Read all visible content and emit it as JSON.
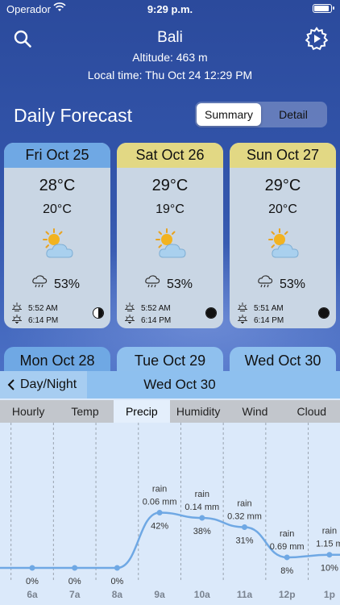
{
  "status_bar": {
    "carrier": "Operador",
    "time": "9:29 p.m."
  },
  "header": {
    "location": "Bali",
    "altitude": "Altitude: 463 m",
    "local_time": "Local time: Thu Oct 24 12:29 PM",
    "search_icon": "search-icon",
    "settings_icon": "gear-play-icon"
  },
  "daily": {
    "title": "Daily Forecast",
    "segments": [
      "Summary",
      "Detail"
    ],
    "selected_segment": "Summary",
    "cards": [
      {
        "day": "Fri Oct 25",
        "high": "28°C",
        "low": "20°C",
        "icon": "partly-cloudy-icon",
        "rain": "53%",
        "sunrise": "5:52 AM",
        "sunset": "6:14 PM",
        "moon": "last-quarter",
        "head_color": "#6fa8e4"
      },
      {
        "day": "Sat Oct 26",
        "high": "29°C",
        "low": "19°C",
        "icon": "partly-cloudy-icon",
        "rain": "53%",
        "sunrise": "5:52 AM",
        "sunset": "6:14 PM",
        "moon": "new",
        "head_color": "#e2d884"
      },
      {
        "day": "Sun Oct 27",
        "high": "29°C",
        "low": "20°C",
        "icon": "partly-cloudy-icon",
        "rain": "53%",
        "sunrise": "5:51 AM",
        "sunset": "6:14 PM",
        "moon": "new",
        "head_color": "#e2d884"
      }
    ],
    "next_cards": [
      {
        "day": "Mon Oct 28",
        "color": "#6fa8e4"
      },
      {
        "day": "Tue Oct 29",
        "color": "#8fc0ee"
      },
      {
        "day": "Wed Oct 30",
        "color": "#8fc0ee"
      }
    ]
  },
  "detail": {
    "back_label": "Day/Night",
    "title": "Wed Oct 30",
    "tabs": [
      "Hourly",
      "Temp",
      "Precip",
      "Humidity",
      "Wind",
      "Cloud"
    ],
    "active_tab": "Precip"
  },
  "chart_data": {
    "type": "line",
    "categories": [
      "6a",
      "7a",
      "8a",
      "9a",
      "10a",
      "11a",
      "12p",
      "1p"
    ],
    "series": [
      {
        "values": [
          0,
          0,
          0,
          42,
          38,
          31,
          8,
          10
        ],
        "labels": [
          "0%",
          "0%",
          "0%",
          "42%",
          "38%",
          "31%",
          "8%",
          "10%"
        ],
        "annotations": [
          null,
          null,
          null,
          [
            "rain",
            "0.06 mm"
          ],
          [
            "rain",
            "0.14 mm"
          ],
          [
            "rain",
            "0.32 mm"
          ],
          [
            "rain",
            "0.69 mm"
          ],
          [
            "rain",
            "1.15 m"
          ]
        ]
      }
    ],
    "ylim": [
      0,
      100
    ],
    "line_color": "#6fa8e4"
  }
}
